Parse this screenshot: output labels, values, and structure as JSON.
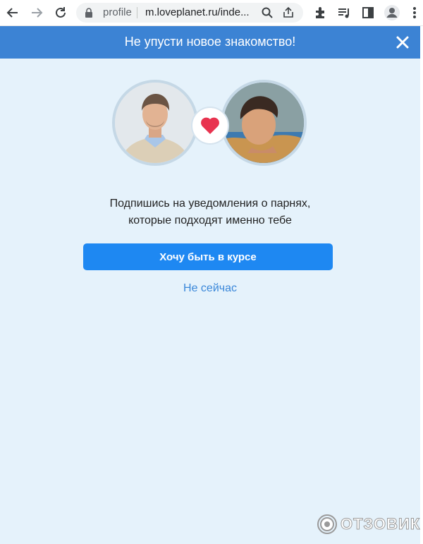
{
  "browser": {
    "site_label": "profile",
    "url": "m.loveplanet.ru/inde..."
  },
  "banner": {
    "title": "Не упусти новое знакомство!"
  },
  "main": {
    "subtitle_line1": "Подпишись на уведомления о парнях,",
    "subtitle_line2": "которые подходят именно тебе",
    "cta_label": "Хочу быть в курсе",
    "dismiss_label": "Не сейчас"
  },
  "watermark": {
    "text": "ОТЗОВИК"
  },
  "colors": {
    "banner": "#3c83d4",
    "page_bg": "#e5f2fb",
    "cta": "#1e88f2",
    "link": "#3a87d9",
    "heart": "#e8334f"
  },
  "icons": [
    "back-arrow-icon",
    "forward-arrow-icon",
    "reload-icon",
    "lock-icon",
    "search-icon",
    "share-icon",
    "extensions-icon",
    "media-icon",
    "sidebar-icon",
    "profile-icon",
    "close-icon",
    "heart-icon"
  ]
}
